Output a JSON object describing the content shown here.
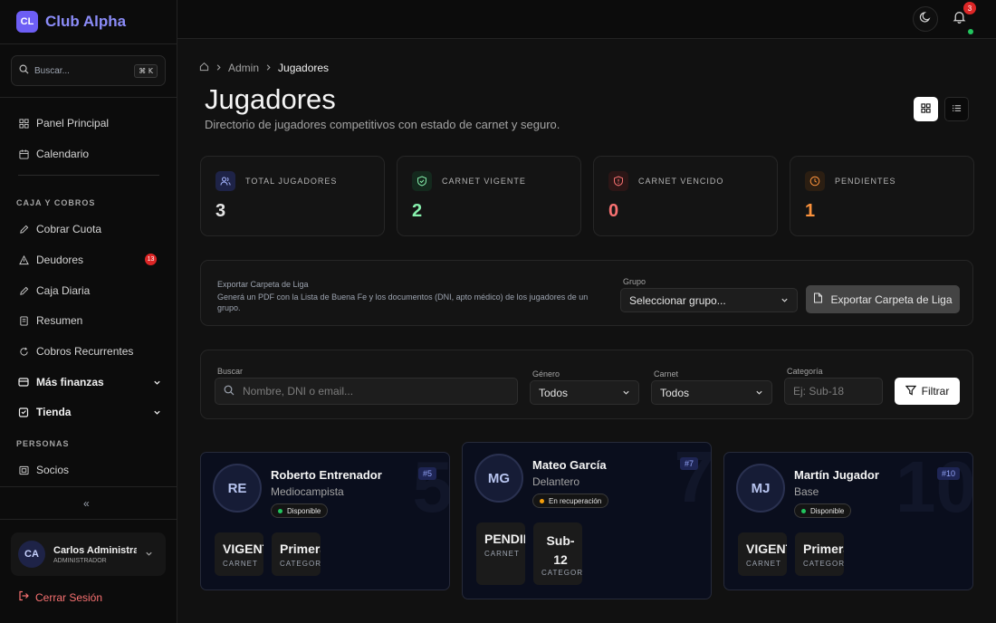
{
  "brand": {
    "logo": "CL",
    "name": "Club Alpha"
  },
  "sidebar": {
    "search_placeholder": "Buscar...",
    "search_shortcut": "⌘ K",
    "items_top": [
      {
        "label": "Panel Principal",
        "icon": "dashboard-icon"
      },
      {
        "label": "Calendario",
        "icon": "calendar-icon"
      }
    ],
    "section_caja": "CAJA Y COBROS",
    "items_caja": [
      {
        "label": "Cobrar Cuota",
        "icon": "pencil-icon"
      },
      {
        "label": "Deudores",
        "icon": "warning-icon",
        "badge": "13"
      },
      {
        "label": "Caja Diaria",
        "icon": "pencil-icon"
      },
      {
        "label": "Resumen",
        "icon": "document-icon"
      },
      {
        "label": "Cobros Recurrentes",
        "icon": "refresh-icon"
      },
      {
        "label": "Más finanzas",
        "icon": "wallet-icon"
      },
      {
        "label": "Tienda",
        "icon": "store-icon"
      }
    ],
    "section_personas": "PERSONAS",
    "items_personas": [
      {
        "label": "Socios",
        "icon": "id-card-icon"
      }
    ],
    "collapse_label": "«",
    "user": {
      "initials": "CA",
      "name": "Carlos Administrador",
      "role": "ADMINISTRADOR"
    },
    "logout_label": "Cerrar Sesión"
  },
  "topbar": {
    "notifications": "3"
  },
  "breadcrumb": {
    "parent": "Admin",
    "current": "Jugadores"
  },
  "page": {
    "title": "Jugadores",
    "subtitle": "Directorio de jugadores competitivos con estado de carnet y seguro."
  },
  "stats": [
    {
      "label": "TOTAL JUGADORES",
      "value": "3",
      "color": "#e5e5e5",
      "icon": "users-icon"
    },
    {
      "label": "CARNET VIGENTE",
      "value": "2",
      "color": "#86efac",
      "icon": "shield-check-icon"
    },
    {
      "label": "CARNET VENCIDO",
      "value": "0",
      "color": "#f87171",
      "icon": "shield-alert-icon"
    },
    {
      "label": "PENDIENTES",
      "value": "1",
      "color": "#fb923c",
      "icon": "clock-icon"
    }
  ],
  "export": {
    "title": "Exportar Carpeta de Liga",
    "description": "Generá un PDF con la Lista de Buena Fe y los documentos (DNI, apto médico) de los jugadores de un grupo.",
    "group_label": "Grupo",
    "group_value": "Seleccionar grupo...",
    "button_label": "Exportar Carpeta de Liga"
  },
  "filters": {
    "search_label": "Buscar",
    "search_placeholder": "Nombre, DNI o email...",
    "gender_label": "Género",
    "gender_value": "Todos",
    "carnet_label": "Carnet",
    "carnet_value": "Todos",
    "category_label": "Categoría",
    "category_placeholder": "Ej: Sub-18",
    "filter_button": "Filtrar"
  },
  "players": [
    {
      "initials": "RE",
      "name": "Roberto Entrenador",
      "position": "Mediocampista",
      "status": "Disponible",
      "status_color": "#22c55e",
      "number": "#5",
      "bignum": "5",
      "carnet": "VIGENTE",
      "carnet_label": "CARNET",
      "category": "Primera",
      "category_label": "CATEGORÍA"
    },
    {
      "initials": "MG",
      "name": "Mateo García",
      "position": "Delantero",
      "status": "En recuperación",
      "status_color": "#f59e0b",
      "number": "#7",
      "bignum": "7",
      "carnet": "PENDIENTE",
      "carnet_label": "CARNET",
      "category": "Sub-12",
      "category_label": "CATEGORÍA"
    },
    {
      "initials": "MJ",
      "name": "Martín Jugador",
      "position": "Base",
      "status": "Disponible",
      "status_color": "#22c55e",
      "number": "#10",
      "bignum": "10",
      "carnet": "VIGENTE",
      "carnet_label": "CARNET",
      "category": "Primera",
      "category_label": "CATEGORÍA"
    }
  ]
}
